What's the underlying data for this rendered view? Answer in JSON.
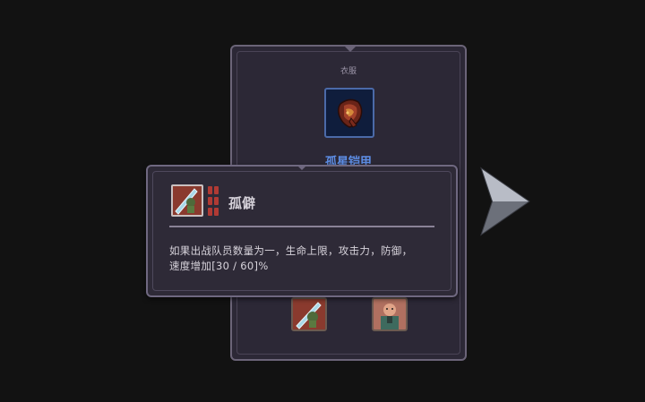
{
  "item_card": {
    "category": "衣服",
    "item_name": "孤星铠甲",
    "item_icon": "armor-icon",
    "skill_slots": [
      {
        "icon": "sword-warrior-icon"
      },
      {
        "icon": "soldier-portrait-icon"
      }
    ]
  },
  "tooltip": {
    "skill_icon": "sword-warrior-icon",
    "skill_name": "孤僻",
    "description_line1": "如果出战队员数量为一，生命上限，攻击力，防御，",
    "description_line2": "速度增加[30 / 60]%"
  },
  "nav": {
    "next_icon": "arrow-right-icon"
  },
  "colors": {
    "background": "#121212",
    "panel": "#2c2836",
    "item_name": "#5e8fe8",
    "rank": "#b13a34"
  }
}
